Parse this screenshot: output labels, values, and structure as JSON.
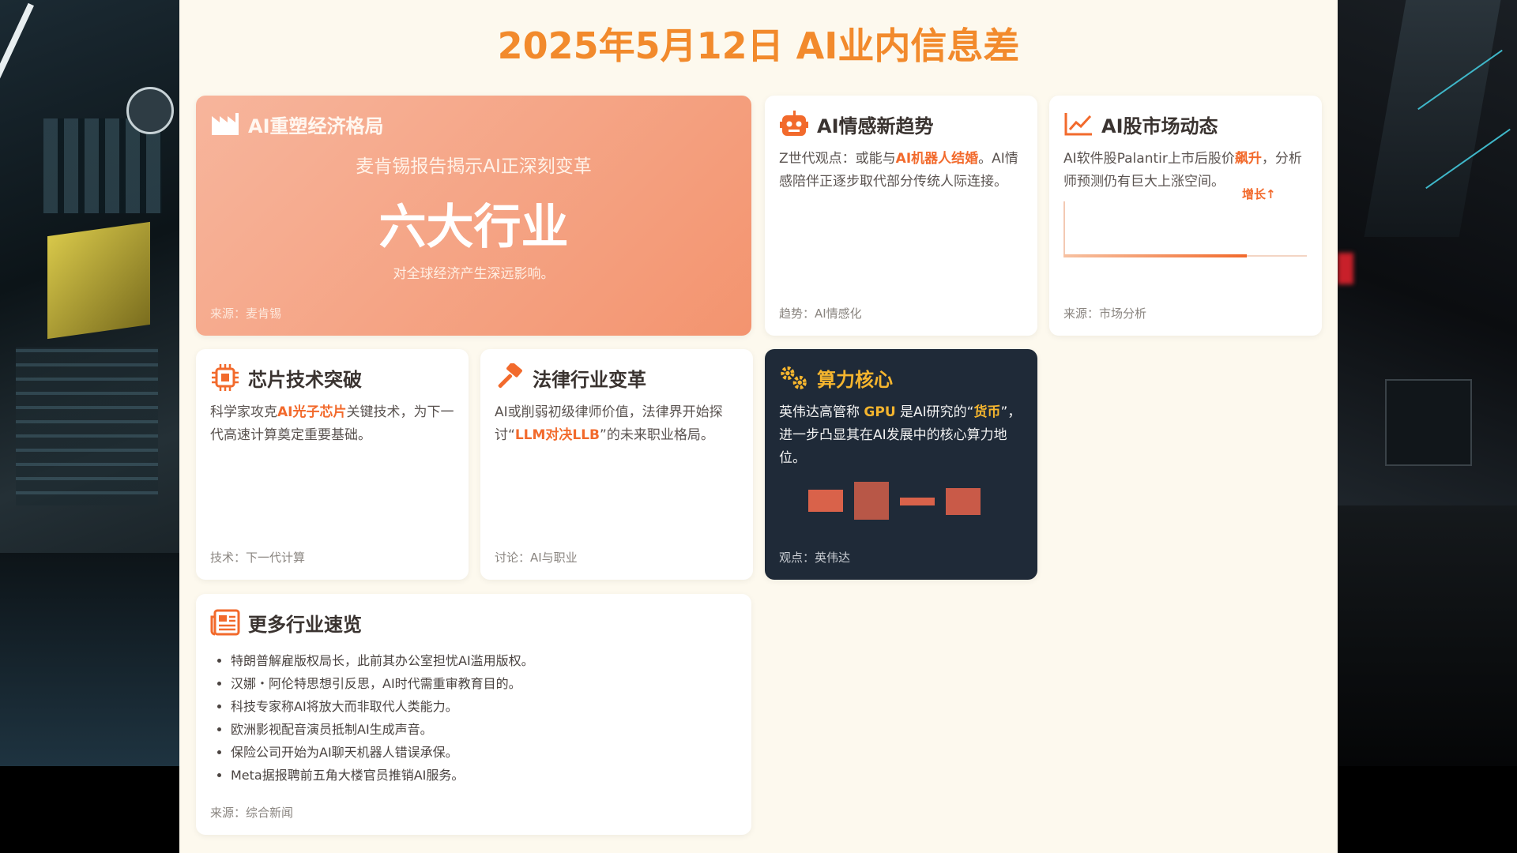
{
  "title": "2025年5月12日 AI业内信息差",
  "colors": {
    "accent": "#f28a2c",
    "highlight": "#f26a2c",
    "dark_card": "#1f2a38",
    "gold": "#f5b52e"
  },
  "cards": {
    "economy": {
      "icon": "factory-icon",
      "title": "AI重塑经济格局",
      "subtitle": "麦肯锡报告揭示AI正深刻变革",
      "big": "六大行业",
      "note": "对全球经济产生深远影响。",
      "footer": "来源：麦肯锡"
    },
    "emotion": {
      "icon": "robot-icon",
      "title": "AI情感新趋势",
      "text_1": "Z世代观点：或能与",
      "highlight": "AI机器人结婚",
      "text_2": "。AI情感陪伴正逐步取代部分传统人际连接。",
      "footer": "趋势：AI情感化"
    },
    "stock": {
      "icon": "line-chart-icon",
      "title": "AI股市场动态",
      "text_1": "AI软件股Palantir上市后股价",
      "highlight": "飙升",
      "text_2": "，分析师预测仍有巨大上涨空间。",
      "growth_label": "增长↑",
      "footer": "来源：市场分析"
    },
    "chip": {
      "icon": "chip-icon",
      "title": "芯片技术突破",
      "text_1": "科学家攻克",
      "highlight": "AI光子芯片",
      "text_2": "关键技术，为下一代高速计算奠定重要基础。",
      "footer": "技术：下一代计算"
    },
    "law": {
      "icon": "gavel-icon",
      "title": "法律行业变革",
      "text_1": "AI或削弱初级律师价值，法律界开始探讨“",
      "highlight": "LLM对决LLB",
      "text_2": "”的未来职业格局。",
      "footer": "讨论：AI与职业"
    },
    "compute": {
      "icon": "gears-icon",
      "title": "算力核心",
      "text_1": "英伟达高管称 ",
      "highlight_1": "GPU",
      "text_2": " 是AI研究的“",
      "highlight_2": "货币",
      "text_3": "”，进一步凸显其在AI发展中的核心算力地位。",
      "footer": "观点：英伟达"
    },
    "more": {
      "icon": "newspaper-icon",
      "title": "更多行业速览",
      "items": [
        "特朗普解雇版权局长，此前其办公室担忧AI滥用版权。",
        "汉娜・阿伦特思想引反思，AI时代需重审教育目的。",
        "科技专家称AI将放大而非取代人类能力。",
        "欧洲影视配音演员抵制AI生成声音。",
        "保险公司开始为AI聊天机器人错误承保。",
        "Meta据报聘前五角大楼官员推销AI服务。"
      ],
      "footer": "来源：综合新闻"
    }
  }
}
